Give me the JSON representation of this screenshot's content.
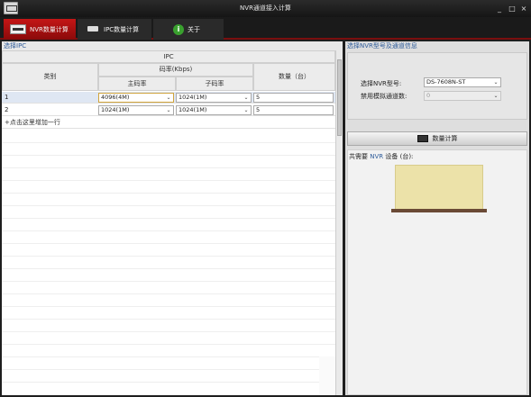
{
  "window": {
    "title": "NVR通道接入计算",
    "controls": [
      "_",
      "□",
      "×"
    ]
  },
  "tabs": [
    {
      "label": "NVR数量计算",
      "icon": "nvr-device-icon",
      "active": true
    },
    {
      "label": "IPC数量计算",
      "icon": "camera-icon",
      "active": false
    },
    {
      "label": "关于",
      "icon": "info-icon",
      "active": false
    }
  ],
  "left": {
    "section_title": "选择IPC",
    "header": {
      "group": "IPC",
      "category": "类别",
      "bitrate_group": "码率(Kbps)",
      "main_stream": "主码率",
      "sub_stream": "子码率",
      "quantity": "数量（台）"
    },
    "rows": [
      {
        "category": "1",
        "main": "4096(4M)",
        "sub": "1024(1M)",
        "qty": "5"
      },
      {
        "category": "2",
        "main": "1024(1M)",
        "sub": "1024(1M)",
        "qty": "5"
      }
    ],
    "add_row": "+点击这里增加一行"
  },
  "right": {
    "section_title": "选择NVR型号及通道信息",
    "nvr_model_label": "选择NVR型号:",
    "nvr_model_value": "DS-7608N-ST",
    "analog_label": "禁用模拟通道数:",
    "analog_value": "0",
    "calc_button": "数量计算",
    "result_prefix": "共需要",
    "result_nvr": "NVR",
    "result_suffix": "设备 (台):",
    "colors": {
      "accent": "#c41616",
      "link": "#2f5c9a",
      "device": "#ece2a9"
    }
  }
}
